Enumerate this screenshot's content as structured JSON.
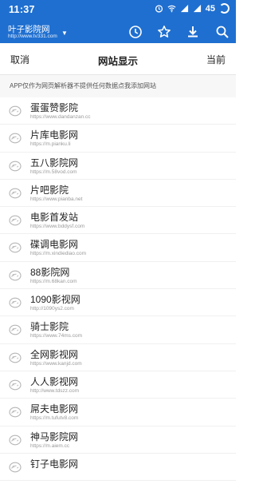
{
  "status_bar": {
    "time": "11:37",
    "battery": "45",
    "icons": [
      "alarm-icon",
      "wifi-icon",
      "signal-icon",
      "signal-icon",
      "battery-icon",
      "loading-ring-icon"
    ]
  },
  "app_bar": {
    "site_title": "叶子影院网",
    "site_url": "http://www.tv331.com",
    "actions": [
      "history-icon",
      "star-icon",
      "download-icon",
      "search-icon"
    ]
  },
  "sheet": {
    "cancel_label": "取消",
    "title": "网站显示",
    "current_label": "当前",
    "disclaimer": "APP仅作为网页解析器不提供任何数据点我添加网站",
    "sites": [
      {
        "name": "蛋蛋赞影院",
        "url": "https://www.dandanzan.cc"
      },
      {
        "name": "片库电影网",
        "url": "https://m.pianku.li"
      },
      {
        "name": "五八影院网",
        "url": "https://m.58vod.com"
      },
      {
        "name": "片吧影院",
        "url": "https://www.pianba.net"
      },
      {
        "name": "电影首发站",
        "url": "https://www.bddysf.com"
      },
      {
        "name": "碟调电影网",
        "url": "https://m.xindiediao.com"
      },
      {
        "name": "88影院网",
        "url": "https://m.68kan.com"
      },
      {
        "name": "1090影视网",
        "url": "http://1090ys2.com"
      },
      {
        "name": "骑士影院",
        "url": "https://www.74ms.com"
      },
      {
        "name": "全网影视网",
        "url": "https://www.kanjd.com"
      },
      {
        "name": "人人影视网",
        "url": "http://www.tdszz.com"
      },
      {
        "name": "屌夫电影网",
        "url": "https://m.tufutv8.com"
      },
      {
        "name": "神马影院网",
        "url": "https://m.aiem.cc"
      },
      {
        "name": "钉子电影网",
        "url": ""
      }
    ]
  },
  "colors": {
    "primary": "#1f6fd0",
    "text": "#222222",
    "muted": "#9a9a9a"
  }
}
